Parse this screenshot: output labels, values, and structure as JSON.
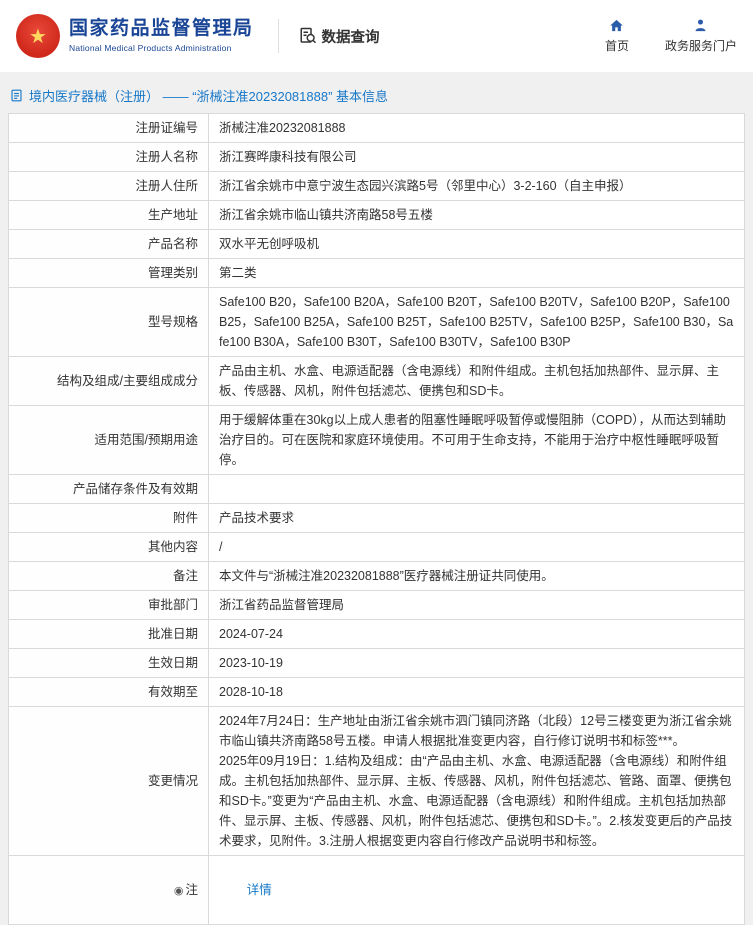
{
  "header": {
    "title_cn": "国家药品监督管理局",
    "title_en": "National Medical Products Administration",
    "data_query": "数据查询",
    "nav_home": "首页",
    "nav_portal": "政务服务门户"
  },
  "page": {
    "title": "境内医疗器械（注册） —— “浙械注准20232081888” 基本信息"
  },
  "table": {
    "rows": [
      {
        "label": "注册证编号",
        "value": "浙械注准20232081888"
      },
      {
        "label": "注册人名称",
        "value": "浙江赛晔康科技有限公司"
      },
      {
        "label": "注册人住所",
        "value": "浙江省余姚市中意宁波生态园兴滨路5号（邻里中心）3-2-160（自主申报）"
      },
      {
        "label": "生产地址",
        "value": "浙江省余姚市临山镇共济南路58号五楼"
      },
      {
        "label": "产品名称",
        "value": "双水平无创呼吸机"
      },
      {
        "label": "管理类别",
        "value": "第二类"
      },
      {
        "label": "型号规格",
        "value": "Safe100 B20，Safe100 B20A，Safe100 B20T，Safe100 B20TV，Safe100 B20P，Safe100 B25，Safe100 B25A，Safe100 B25T，Safe100 B25TV，Safe100 B25P，Safe100 B30，Safe100 B30A，Safe100 B30T，Safe100 B30TV，Safe100 B30P"
      },
      {
        "label": "结构及组成/主要组成成分",
        "value": "产品由主机、水盒、电源适配器（含电源线）和附件组成。主机包括加热部件、显示屏、主板、传感器、风机，附件包括滤芯、便携包和SD卡。"
      },
      {
        "label": "适用范围/预期用途",
        "value": "用于缓解体重在30kg以上成人患者的阻塞性睡眠呼吸暂停或慢阻肺（COPD），从而达到辅助治疗目的。可在医院和家庭环境使用。不可用于生命支持，不能用于治疗中枢性睡眠呼吸暂停。"
      },
      {
        "label": "产品储存条件及有效期",
        "value": ""
      },
      {
        "label": "附件",
        "value": "产品技术要求"
      },
      {
        "label": "其他内容",
        "value": "/"
      },
      {
        "label": "备注",
        "value": "本文件与“浙械注准20232081888”医疗器械注册证共同使用。"
      },
      {
        "label": "审批部门",
        "value": "浙江省药品监督管理局"
      },
      {
        "label": "批准日期",
        "value": "2024-07-24"
      },
      {
        "label": "生效日期",
        "value": "2023-10-19"
      },
      {
        "label": "有效期至",
        "value": "2028-10-18"
      },
      {
        "label": "变更情况",
        "value": "2024年7月24日：生产地址由浙江省余姚市泗门镇同济路（北段）12号三楼变更为浙江省余姚市临山镇共济南路58号五楼。申请人根据批准变更内容，自行修订说明书和标签***。\n2025年09月19日：1.结构及组成：由“产品由主机、水盒、电源适配器（含电源线）和附件组成。主机包括加热部件、显示屏、主板、传感器、风机，附件包括滤芯、管路、面罩、便携包和SD卡。”变更为“产品由主机、水盒、电源适配器（含电源线）和附件组成。主机包括加热部件、显示屏、主板、传感器、风机，附件包括滤芯、便携包和SD卡。”。2.核发变更后的产品技术要求，见附件。3.注册人根据变更内容自行修改产品说明书和标签。"
      },
      {
        "label": "注",
        "value": "详情"
      }
    ]
  }
}
